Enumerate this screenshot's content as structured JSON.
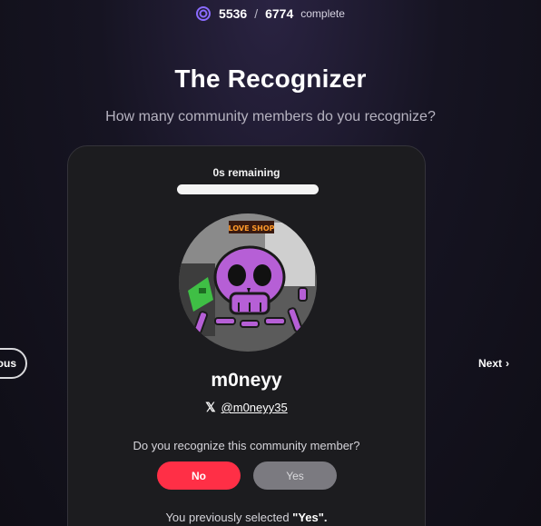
{
  "progress": {
    "completed": "5536",
    "separator": "/",
    "total": "6774",
    "label": "complete",
    "icon": "target-icon"
  },
  "header": {
    "title": "The Recognizer",
    "subtitle": "How many community members do you recognize?"
  },
  "card": {
    "timer_label": "0s remaining",
    "timer_fraction": 1.0,
    "member": {
      "username": "m0neyy",
      "handle": "@m0neyy35",
      "social_icon": "x-logo-icon",
      "avatar_sign_text": "LOVE SHOP"
    },
    "question": "Do you recognize this community member?",
    "buttons": {
      "no": "No",
      "yes": "Yes"
    },
    "previous_note_prefix": "You previously selected ",
    "previous_note_value": "\"Yes\".",
    "colors": {
      "no_button": "#ff2f46",
      "yes_button": "#7b7a80",
      "accent": "#7c5cff"
    }
  },
  "nav": {
    "previous_label": "ous",
    "next_label": "Next",
    "next_icon": "chevron-right-icon"
  }
}
